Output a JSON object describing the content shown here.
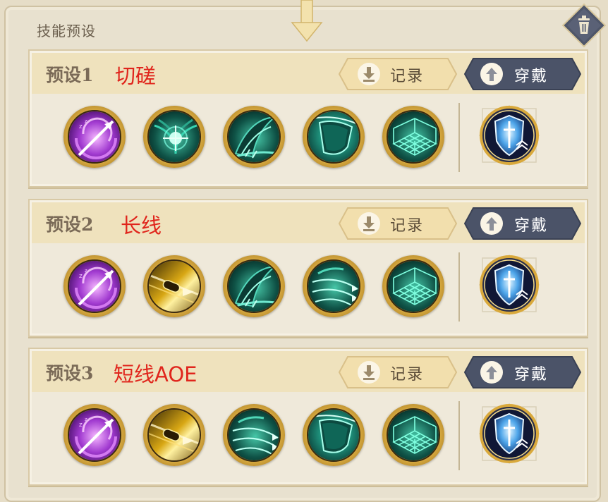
{
  "panel": {
    "title": "技能预设"
  },
  "buttons": {
    "record_label": "记录",
    "wear_label": "穿戴"
  },
  "presets": [
    {
      "name": "预设1",
      "note": "切磋",
      "skills": [
        "purple-spiral-arrow",
        "teal-radiant-burst",
        "teal-wing-slash",
        "teal-shield",
        "teal-grid-net"
      ]
    },
    {
      "name": "预设2",
      "note": "长线",
      "skills": [
        "purple-spiral-arrow",
        "gold-bullet-charge",
        "teal-wing-slash",
        "teal-feather-arrows",
        "teal-grid-net"
      ]
    },
    {
      "name": "预设3",
      "note": "短线AOE",
      "skills": [
        "purple-spiral-arrow",
        "gold-bullet-charge",
        "teal-feather-arrows",
        "teal-shield",
        "teal-grid-net"
      ]
    }
  ],
  "colors": {
    "note_red": "#e0251c",
    "wear_button": "#4b5368",
    "record_button": "#f2dfad",
    "gold_ring": "#d7a93f"
  },
  "icons": {
    "trash": "trash-icon",
    "down_arrow": "download-arrow-icon",
    "up_arrow": "upload-arrow-icon",
    "ultimate": "blue-crystal-shield-icon"
  }
}
